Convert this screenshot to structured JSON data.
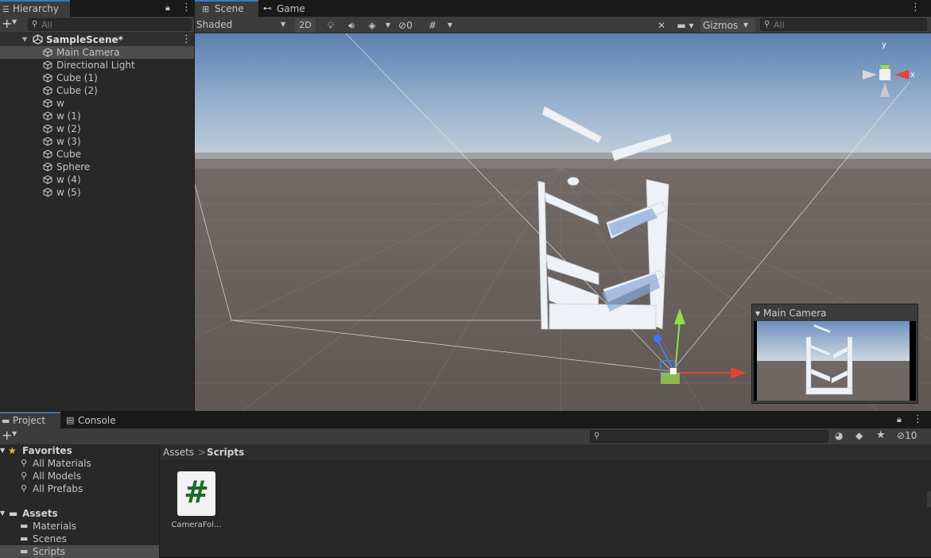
{
  "hierarchy": {
    "tab_label": "Hierarchy",
    "search_placeholder": "All",
    "scene_name": "SampleScene*",
    "items": [
      {
        "label": "Main Camera",
        "selected": true
      },
      {
        "label": "Directional Light"
      },
      {
        "label": "Cube (1)"
      },
      {
        "label": "Cube (2)"
      },
      {
        "label": "w"
      },
      {
        "label": "w (1)"
      },
      {
        "label": "w (2)"
      },
      {
        "label": "w (3)"
      },
      {
        "label": "Cube"
      },
      {
        "label": "Sphere"
      },
      {
        "label": "w (4)"
      },
      {
        "label": "w (5)"
      }
    ]
  },
  "scene": {
    "tabs": [
      "Scene",
      "Game"
    ],
    "shading_mode": "Shaded",
    "mode_2d": "2D",
    "hidden_count": "0",
    "gizmos_label": "Gizmos",
    "search_placeholder": "All",
    "gizmo_axes": {
      "y": "y",
      "x": "x"
    },
    "camera_preview_title": "Main Camera"
  },
  "project": {
    "tabs": [
      "Project",
      "Console"
    ],
    "favorites_label": "Favorites",
    "favorites": [
      "All Materials",
      "All Models",
      "All Prefabs"
    ],
    "assets_label": "Assets",
    "asset_folders": [
      "Materials",
      "Scenes",
      "Scripts"
    ],
    "breadcrumb": {
      "root": "Assets",
      "separator": ">",
      "current": "Scripts"
    },
    "hidden_count": "10",
    "files": [
      {
        "name": "CameraFol...",
        "glyph": "#"
      }
    ]
  },
  "colors": {
    "accent": "#3a79bb",
    "panel": "#282828",
    "toolbar": "#3c3c3c",
    "selection": "#4d4d4d",
    "csharp_icon": "#1e6b2a"
  }
}
